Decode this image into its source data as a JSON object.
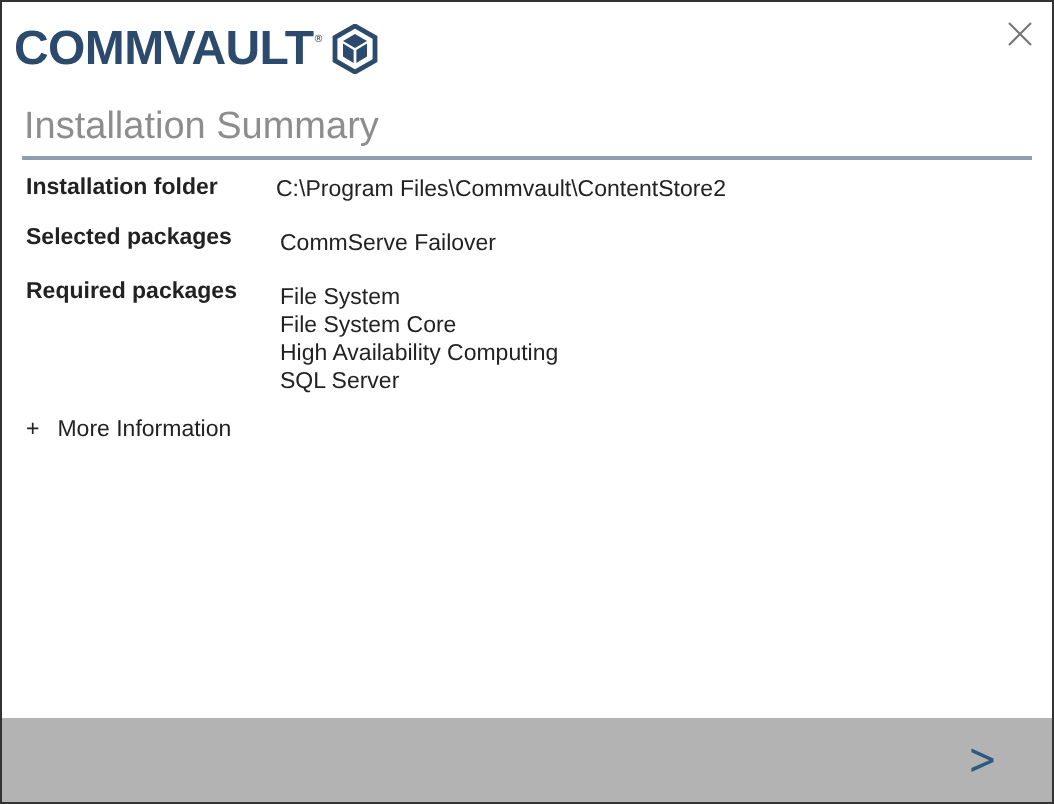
{
  "logo": {
    "text": "COMMVAULT",
    "mark": "®"
  },
  "title": "Installation Summary",
  "rows": [
    {
      "label": "Installation folder",
      "values": [
        "C:\\Program Files\\Commvault\\ContentStore2"
      ]
    },
    {
      "label": "Selected packages",
      "values": [
        "CommServe Failover"
      ]
    },
    {
      "label": "Required packages",
      "values": [
        "File System",
        "File System Core",
        "High Availability Computing",
        "SQL Server"
      ]
    }
  ],
  "more": {
    "icon": "+",
    "label": "More Information",
    "expanded": false
  },
  "footer": {
    "next": ">"
  }
}
